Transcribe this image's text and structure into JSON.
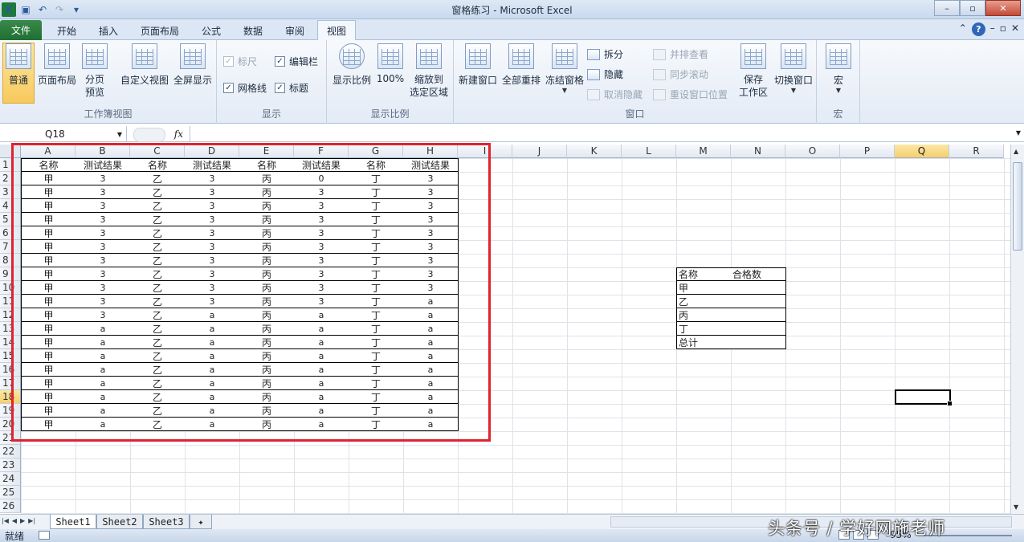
{
  "window": {
    "title": "窗格练习 - Microsoft Excel",
    "logo": "X",
    "controls": [
      "–",
      "▫",
      "✕"
    ]
  },
  "ribbon_tabs": {
    "file": "文件",
    "items": [
      "开始",
      "插入",
      "页面布局",
      "公式",
      "数据",
      "审阅",
      "视图"
    ],
    "active": "视图"
  },
  "ribbon": {
    "workbook_views": {
      "label": "工作簿视图",
      "normal": "普通",
      "page_layout": "页面布局",
      "page_break_1": "分页",
      "page_break_2": "预览",
      "custom_views": "自定义视图",
      "full_screen": "全屏显示"
    },
    "show": {
      "label": "显示",
      "ruler": "标尺",
      "formula_bar": "编辑栏",
      "gridlines": "网格线",
      "headings": "标题"
    },
    "zoom": {
      "label": "显示比例",
      "zoom": "显示比例",
      "hundred": "100%",
      "zoom_selection_1": "缩放到",
      "zoom_selection_2": "选定区域"
    },
    "window": {
      "label": "窗口",
      "new_window": "新建窗口",
      "arrange_all": "全部重排",
      "freeze_panes": "冻结窗格",
      "split": "拆分",
      "hide": "隐藏",
      "unhide": "取消隐藏",
      "side_by_side": "并排查看",
      "sync_scroll": "同步滚动",
      "reset_position": "重设窗口位置",
      "save_ws_1": "保存",
      "save_ws_2": "工作区",
      "switch_windows": "切换窗口"
    },
    "macros": {
      "label": "宏",
      "macros": "宏"
    }
  },
  "formula_bar": {
    "name_box": "Q18",
    "fx": "fx",
    "formula": ""
  },
  "grid": {
    "columns": [
      "A",
      "B",
      "C",
      "D",
      "E",
      "F",
      "G",
      "H",
      "I",
      "J",
      "K",
      "L",
      "M",
      "N",
      "O",
      "P",
      "Q",
      "R"
    ],
    "selected_column": "Q",
    "rows": [
      "1",
      "2",
      "3",
      "4",
      "5",
      "6",
      "7",
      "8",
      "9",
      "10",
      "11",
      "12",
      "13",
      "14",
      "15",
      "16",
      "17",
      "18",
      "19",
      "20",
      "21",
      "22",
      "23",
      "24",
      "25",
      "26"
    ],
    "selected_row": "18",
    "header_row": [
      "名称",
      "测试结果",
      "名称",
      "测试结果",
      "名称",
      "测试结果",
      "名称",
      "测试结果"
    ],
    "data_rows": [
      [
        "甲",
        "3",
        "乙",
        "3",
        "丙",
        "0",
        "丁",
        "3"
      ],
      [
        "甲",
        "3",
        "乙",
        "3",
        "丙",
        "3",
        "丁",
        "3"
      ],
      [
        "甲",
        "3",
        "乙",
        "3",
        "丙",
        "3",
        "丁",
        "3"
      ],
      [
        "甲",
        "3",
        "乙",
        "3",
        "丙",
        "3",
        "丁",
        "3"
      ],
      [
        "甲",
        "3",
        "乙",
        "3",
        "丙",
        "3",
        "丁",
        "3"
      ],
      [
        "甲",
        "3",
        "乙",
        "3",
        "丙",
        "3",
        "丁",
        "3"
      ],
      [
        "甲",
        "3",
        "乙",
        "3",
        "丙",
        "3",
        "丁",
        "3"
      ],
      [
        "甲",
        "3",
        "乙",
        "3",
        "丙",
        "3",
        "丁",
        "3"
      ],
      [
        "甲",
        "3",
        "乙",
        "3",
        "丙",
        "3",
        "丁",
        "3"
      ],
      [
        "甲",
        "3",
        "乙",
        "3",
        "丙",
        "3",
        "丁",
        "a"
      ],
      [
        "甲",
        "3",
        "乙",
        "a",
        "丙",
        "a",
        "丁",
        "a"
      ],
      [
        "甲",
        "a",
        "乙",
        "a",
        "丙",
        "a",
        "丁",
        "a"
      ],
      [
        "甲",
        "a",
        "乙",
        "a",
        "丙",
        "a",
        "丁",
        "a"
      ],
      [
        "甲",
        "a",
        "乙",
        "a",
        "丙",
        "a",
        "丁",
        "a"
      ],
      [
        "甲",
        "a",
        "乙",
        "a",
        "丙",
        "a",
        "丁",
        "a"
      ],
      [
        "甲",
        "a",
        "乙",
        "a",
        "丙",
        "a",
        "丁",
        "a"
      ],
      [
        "甲",
        "a",
        "乙",
        "a",
        "丙",
        "a",
        "丁",
        "a"
      ],
      [
        "甲",
        "a",
        "乙",
        "a",
        "丙",
        "a",
        "丁",
        "a"
      ],
      [
        "甲",
        "a",
        "乙",
        "a",
        "丙",
        "a",
        "丁",
        "a"
      ]
    ],
    "summary": {
      "header": [
        "名称",
        "合格数"
      ],
      "rows": [
        [
          "甲",
          ""
        ],
        [
          "乙",
          ""
        ],
        [
          "丙",
          ""
        ],
        [
          "丁",
          ""
        ],
        [
          "总计",
          ""
        ]
      ]
    }
  },
  "sheet_tabs": [
    "Sheet1",
    "Sheet2",
    "Sheet3"
  ],
  "active_sheet": "Sheet1",
  "status": {
    "ready": "就绪",
    "zoom": "95%"
  },
  "watermark": "头条号 / 学好网施老师"
}
